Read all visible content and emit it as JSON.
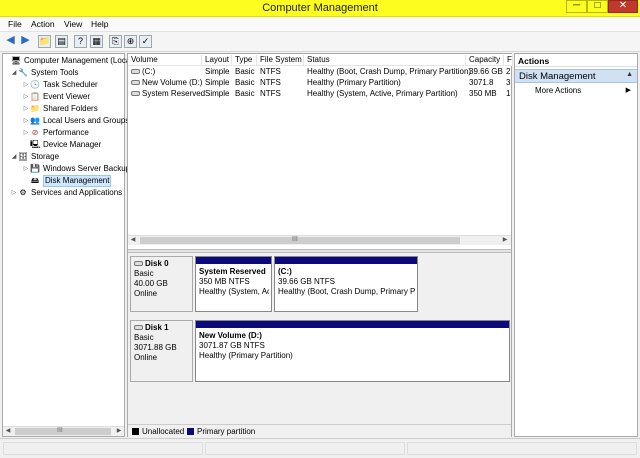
{
  "window": {
    "title": "Computer Management"
  },
  "window_controls": {
    "minimize": "─",
    "maximize": "□",
    "close": "✕"
  },
  "menu": [
    "File",
    "Action",
    "View",
    "Help"
  ],
  "toolbar": {
    "back": "◀",
    "forward": "▶",
    "up_folder": "📁",
    "show_hide_tree": "▤",
    "help": "?",
    "properties": "▦",
    "export": "⎘",
    "connect": "⊕",
    "settings": "✓"
  },
  "tree": [
    {
      "label": "Computer Management (Local",
      "exp": "",
      "icon": "🖥"
    },
    {
      "label": "System Tools",
      "exp": "◢",
      "icon": "🔧"
    },
    {
      "label": "Task Scheduler",
      "exp": "▷",
      "icon": "🕓"
    },
    {
      "label": "Event Viewer",
      "exp": "▷",
      "icon": "📋"
    },
    {
      "label": "Shared Folders",
      "exp": "▷",
      "icon": "📁"
    },
    {
      "label": "Local Users and Groups",
      "exp": "▷",
      "icon": "👥"
    },
    {
      "label": "Performance",
      "exp": "▷",
      "icon": "⊘"
    },
    {
      "label": "Device Manager",
      "exp": "",
      "icon": "🖳"
    },
    {
      "label": "Storage",
      "exp": "◢",
      "icon": "🗄"
    },
    {
      "label": "Windows Server Backup",
      "exp": "▷",
      "icon": "💾"
    },
    {
      "label": "Disk Management",
      "exp": "",
      "icon": "🖴"
    },
    {
      "label": "Services and Applications",
      "exp": "▷",
      "icon": "⚙"
    }
  ],
  "volumes": {
    "headers": [
      "Volume",
      "Layout",
      "Type",
      "File System",
      "Status",
      "Capacity",
      "F"
    ],
    "rows": [
      [
        "(C:)",
        "Simple",
        "Basic",
        "NTFS",
        "Healthy (Boot, Crash Dump, Primary Partition)",
        "39.66 GB",
        "2"
      ],
      [
        "New Volume (D:)",
        "Simple",
        "Basic",
        "NTFS",
        "Healthy (Primary Partition)",
        "3071.8",
        "3"
      ],
      [
        "System Reserved",
        "Simple",
        "Basic",
        "NTFS",
        "Healthy (System, Active, Primary Partition)",
        "350 MB",
        "1"
      ]
    ]
  },
  "scroll": {
    "left": "◀",
    "right": "▶",
    "grip": "III"
  },
  "disks": [
    {
      "name": "Disk 0",
      "type": "Basic",
      "size": "40.00 GB",
      "status": "Online",
      "partitions": [
        {
          "name": "System Reserved",
          "size": "350 MB NTFS",
          "status": "Healthy (System, Ac"
        },
        {
          "name": "(C:)",
          "size": "39.66 GB NTFS",
          "status": "Healthy (Boot, Crash Dump, Primary Pa"
        }
      ]
    },
    {
      "name": "Disk 1",
      "type": "Basic",
      "size": "3071.88 GB",
      "status": "Online",
      "partitions": [
        {
          "name": "New Volume  (D:)",
          "size": "3071.87 GB NTFS",
          "status": "Healthy (Primary Partition)"
        }
      ]
    }
  ],
  "legend": [
    {
      "label": "Unallocated",
      "color": "#000000"
    },
    {
      "label": "Primary partition",
      "color": "#0a0a7a"
    }
  ],
  "actions": {
    "header": "Actions",
    "section": "Disk Management",
    "section_caret": "▲",
    "items": [
      {
        "label": "More Actions",
        "arrow": "▶"
      }
    ]
  },
  "colors": {
    "titlebar": "#fdfd20",
    "partition_bar": "#0a0a7a",
    "selection": "#cde8ff"
  }
}
